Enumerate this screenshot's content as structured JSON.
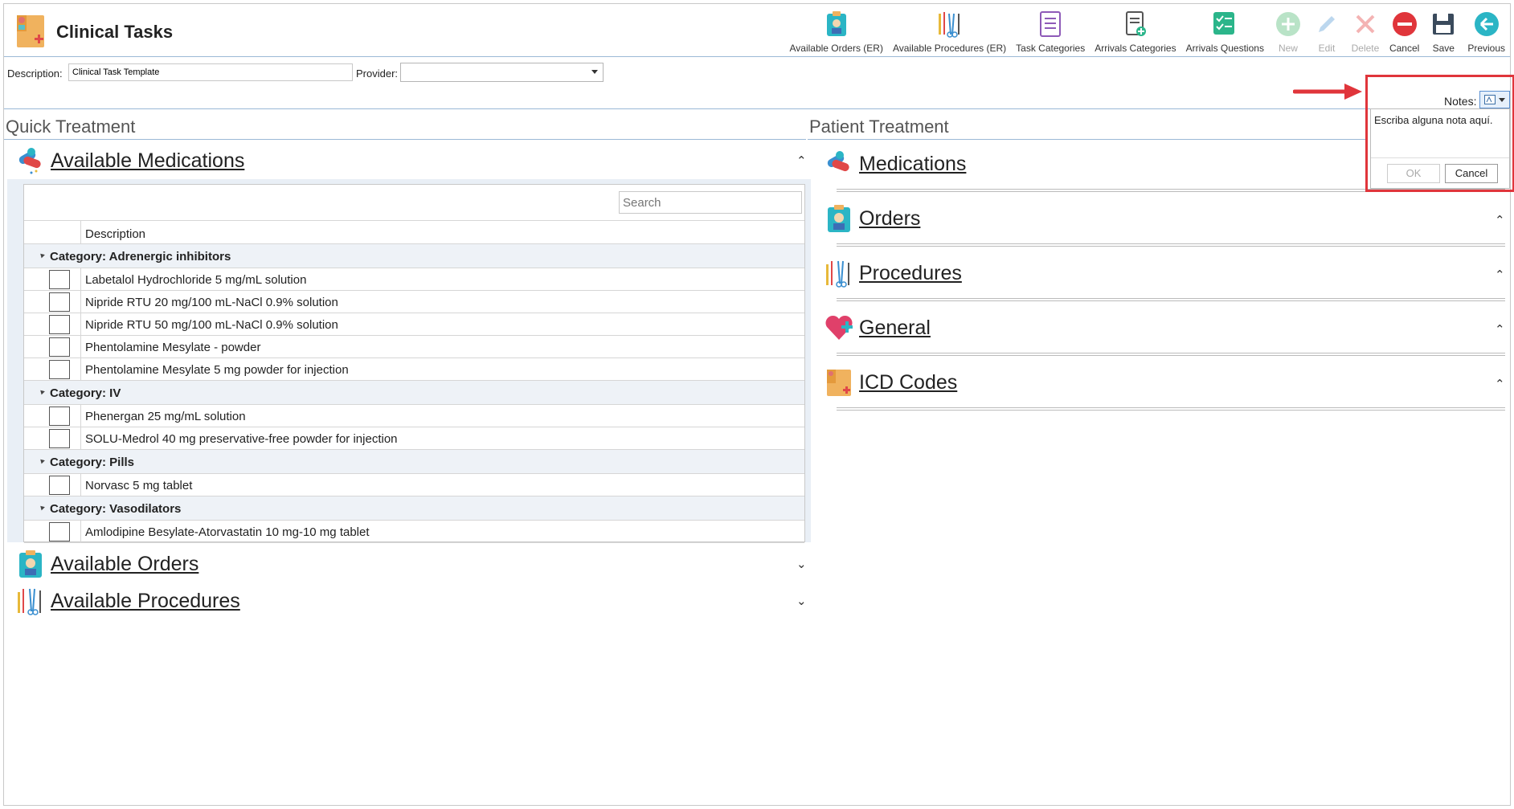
{
  "app": {
    "title": "Clinical Tasks"
  },
  "toolbar": [
    {
      "label": "Available Orders (ER)",
      "icon": "orders-icon",
      "enabled": true
    },
    {
      "label": "Available Procedures (ER)",
      "icon": "procedures-icon",
      "enabled": true
    },
    {
      "label": "Task Categories",
      "icon": "task-categories-icon",
      "enabled": true
    },
    {
      "label": "Arrivals Categories",
      "icon": "arrivals-categories-icon",
      "enabled": true
    },
    {
      "label": "Arrivals Questions",
      "icon": "arrivals-questions-icon",
      "enabled": true
    },
    {
      "label": "New",
      "icon": "plus-icon",
      "enabled": false
    },
    {
      "label": "Edit",
      "icon": "pencil-icon",
      "enabled": false
    },
    {
      "label": "Delete",
      "icon": "delete-x-icon",
      "enabled": false
    },
    {
      "label": "Cancel",
      "icon": "cancel-circle-icon",
      "enabled": true
    },
    {
      "label": "Save",
      "icon": "floppy-icon",
      "enabled": true
    },
    {
      "label": "Previous",
      "icon": "back-arrow-icon",
      "enabled": true
    }
  ],
  "form": {
    "description_label": "Description:",
    "description_value": "Clinical Task Template",
    "provider_label": "Provider:",
    "provider_value": ""
  },
  "notes": {
    "label": "Notes:",
    "text": "Escriba alguna nota aquí.",
    "ok": "OK",
    "cancel": "Cancel"
  },
  "left": {
    "title": "Quick Treatment",
    "medications": {
      "title": "Available Medications",
      "search_placeholder": "Search",
      "column": "Description",
      "groups": [
        {
          "category": "Category: Adrenergic inhibitors",
          "items": [
            "Labetalol Hydrochloride 5 mg/mL solution",
            "Nipride RTU 20 mg/100 mL-NaCl 0.9% solution",
            "Nipride RTU 50 mg/100 mL-NaCl 0.9% solution",
            "Phentolamine Mesylate - powder",
            "Phentolamine Mesylate 5 mg powder for injection"
          ]
        },
        {
          "category": "Category: IV",
          "items": [
            "Phenergan 25 mg/mL solution",
            "SOLU-Medrol 40 mg preservative-free powder for injection"
          ]
        },
        {
          "category": "Category: Pills",
          "items": [
            "Norvasc 5 mg tablet"
          ]
        },
        {
          "category": "Category: Vasodilators",
          "items": [
            "Amlodipine Besylate-Atorvastatin 10 mg-10 mg tablet"
          ]
        }
      ]
    },
    "orders_title": "Available Orders",
    "procedures_title": "Available Procedures"
  },
  "right": {
    "title": "Patient Treatment",
    "groups": [
      "Medications",
      "Orders",
      "Procedures",
      "General",
      "ICD Codes"
    ]
  },
  "colors": {
    "accent_line": "#9bb9d6",
    "annotation_red": "#e0353b"
  }
}
